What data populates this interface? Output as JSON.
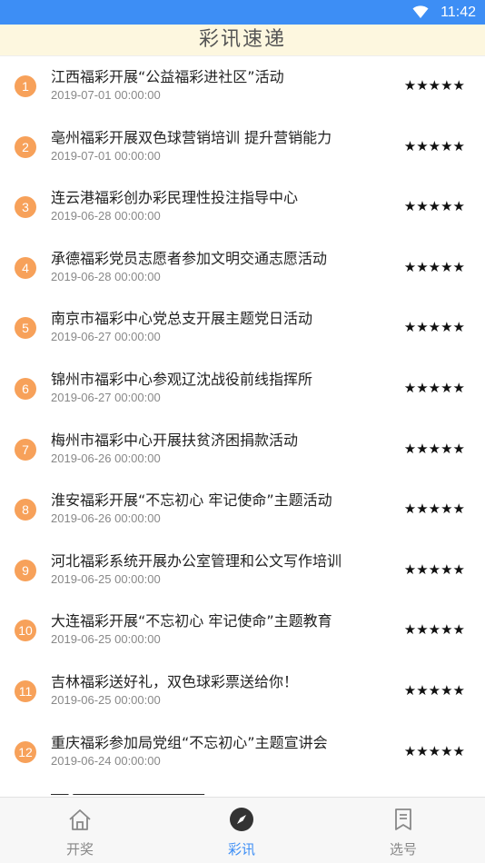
{
  "status_bar": {
    "time": "11:42",
    "wifi_icon": "wifi-icon"
  },
  "header": {
    "title": "彩讯速递"
  },
  "news": [
    {
      "index": "1",
      "title": "江西福彩开展“公益福彩进社区”活动",
      "date": "2019-07-01 00:00:00",
      "stars": "★★★★★"
    },
    {
      "index": "2",
      "title": "亳州福彩开展双色球营销培训 提升营销能力",
      "date": "2019-07-01 00:00:00",
      "stars": "★★★★★"
    },
    {
      "index": "3",
      "title": "连云港福彩创办彩民理性投注指导中心",
      "date": "2019-06-28 00:00:00",
      "stars": "★★★★★"
    },
    {
      "index": "4",
      "title": "承德福彩党员志愿者参加文明交通志愿活动",
      "date": "2019-06-28 00:00:00",
      "stars": "★★★★★"
    },
    {
      "index": "5",
      "title": "南京市福彩中心党总支开展主题党日活动",
      "date": "2019-06-27 00:00:00",
      "stars": "★★★★★"
    },
    {
      "index": "6",
      "title": "锦州市福彩中心参观辽沈战役前线指挥所",
      "date": "2019-06-27 00:00:00",
      "stars": "★★★★★"
    },
    {
      "index": "7",
      "title": "梅州市福彩中心开展扶贫济困捐款活动",
      "date": "2019-06-26 00:00:00",
      "stars": "★★★★★"
    },
    {
      "index": "8",
      "title": "淮安福彩开展“不忘初心 牢记使命”主题活动",
      "date": "2019-06-26 00:00:00",
      "stars": "★★★★★"
    },
    {
      "index": "9",
      "title": "河北福彩系统开展办公室管理和公文写作培训",
      "date": "2019-06-25 00:00:00",
      "stars": "★★★★★"
    },
    {
      "index": "10",
      "title": "大连福彩开展“不忘初心 牢记使命”主题教育",
      "date": "2019-06-25 00:00:00",
      "stars": "★★★★★"
    },
    {
      "index": "11",
      "title": "吉林福彩送好礼，双色球彩票送给你！",
      "date": "2019-06-25 00:00:00",
      "stars": "★★★★★"
    },
    {
      "index": "12",
      "title": "重庆福彩参加局党组“不忘初心”主题宣讲会",
      "date": "2019-06-24 00:00:00",
      "stars": "★★★★★"
    }
  ],
  "colors": {
    "status_bar": "#3d8ef5",
    "header_bg": "#fdf7df",
    "badge": "#f7a15a",
    "tab_active": "#3d8ef5",
    "tab_inactive": "#888888"
  },
  "tabs": [
    {
      "label": "开奖",
      "icon": "home-icon",
      "active": false
    },
    {
      "label": "彩讯",
      "icon": "compass-icon",
      "active": true
    },
    {
      "label": "选号",
      "icon": "bookmark-icon",
      "active": false
    }
  ]
}
